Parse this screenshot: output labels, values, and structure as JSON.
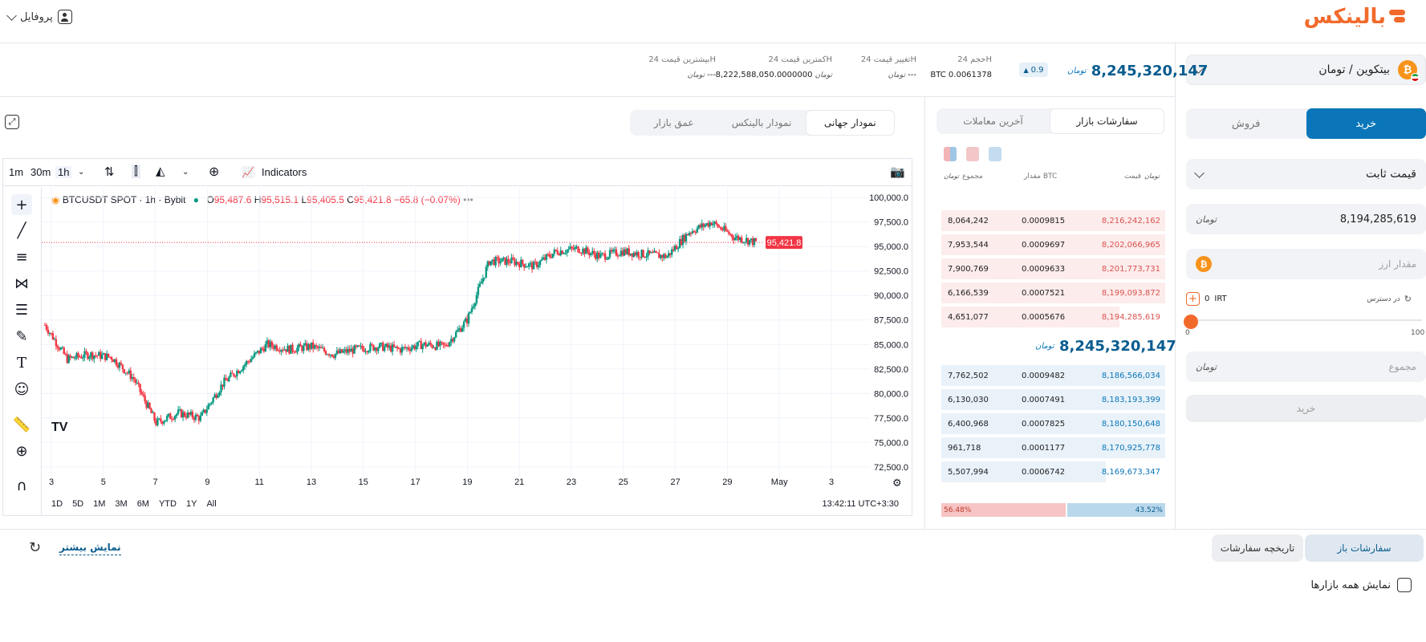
{
  "header": {
    "logo_text": "بالینکس",
    "profile_label": "پروفایل"
  },
  "trade_panel": {
    "pair_label": "بیتکوین / تومان",
    "tabs": [
      "خرید",
      "فروش"
    ],
    "order_type": "قیمت ثابت",
    "price_value": "8,194,285,619",
    "price_unit": "تومان",
    "amount_placeholder": "مقدار ارز",
    "available_label": "در دسترس",
    "available_value": "0",
    "available_unit": "IRT",
    "slider_min": "0",
    "slider_max": "100",
    "slider_level": 0,
    "total_placeholder": "مجموع",
    "submit_label": "خرید"
  },
  "stats": {
    "last_price": "8,245,320,147",
    "change_badge": "0.9",
    "volume_label": "حجم 24H",
    "volume_value": "BTC 0.0061378",
    "change_label": "تغییر قیمت 24H",
    "change_value": "---",
    "low_label": "کمترین قیمت 24H",
    "low_value": "8,222,588,050.0000000",
    "high_label": "بیشترین قیمت 24H",
    "high_value": "---"
  },
  "orderbook": {
    "tabs": [
      "سفارشات بازار",
      "آخرین معاملات"
    ],
    "headers": [
      "قیمت",
      "مقدار BTC",
      "مجموع"
    ],
    "asks": [
      [
        "8,216,242,162",
        "0.0009815",
        "8,064,242"
      ],
      [
        "8,202,066,965",
        "0.0009697",
        "7,953,544"
      ],
      [
        "8,201,773,731",
        "0.0009633",
        "7,900,769"
      ],
      [
        "8,199,093,872",
        "0.0007521",
        "6,166,539"
      ],
      [
        "8,194,285,619",
        "0.0005676",
        "4,651,077"
      ]
    ],
    "mid_price": "8,245,320,147",
    "bids": [
      [
        "8,186,566,034",
        "0.0009482",
        "7,762,502"
      ],
      [
        "8,183,193,399",
        "0.0007491",
        "6,130,030"
      ],
      [
        "8,180,150,648",
        "0.0007825",
        "6,400,968"
      ],
      [
        "8,170,925,778",
        "0.0001177",
        "961,718"
      ],
      [
        "8,169,673,347",
        "0.0006742",
        "5,507,994"
      ]
    ],
    "sell_ratio": "56.48%",
    "buy_ratio": "43.52%"
  },
  "chart_tabs": [
    "نمودار جهانی",
    "نمودار بالینکس",
    "عمق بازار"
  ],
  "tradingview": {
    "intervals": [
      "1m",
      "30m",
      "1h"
    ],
    "indicators_label": "Indicators",
    "symbol": "BTCUSDT SPOT · 1h · Bybit",
    "ohlc": {
      "o_label": "O",
      "o": "95,487.6",
      "h_label": "H",
      "h": "95,515.1",
      "l_label": "L",
      "l": "95,405.5",
      "c_label": "C",
      "c": "95,421.8",
      "chg": "−65.8 (−0.07%)"
    },
    "price_tag": "95,421.8",
    "ranges": [
      "1D",
      "5D",
      "1M",
      "3M",
      "6M",
      "YTD",
      "1Y",
      "All"
    ],
    "clock": "13:42:11 UTC+3:30"
  },
  "chart_data": {
    "type": "line",
    "title": "BTCUSDT SPOT · 1h · Bybit",
    "x_ticks": [
      "3",
      "5",
      "7",
      "9",
      "11",
      "13",
      "15",
      "17",
      "19",
      "21",
      "23",
      "25",
      "27",
      "29",
      "May",
      "3"
    ],
    "y_ticks": [
      "100,000.0",
      "97,500.0",
      "95,000.0",
      "92,500.0",
      "90,000.0",
      "87,500.0",
      "85,000.0",
      "82,500.0",
      "80,000.0",
      "77,500.0",
      "75,000.0",
      "72,500.0"
    ],
    "ylim": [
      71500,
      101000
    ],
    "series": [
      {
        "x": [
          "Apr 2",
          "Apr 3",
          "Apr 4",
          "Apr 5",
          "Apr 6",
          "Apr 7",
          "Apr 8",
          "Apr 9",
          "Apr 10",
          "Apr 11",
          "Apr 12",
          "Apr 13",
          "Apr 14",
          "Apr 15",
          "Apr 16",
          "Apr 17",
          "Apr 18",
          "Apr 19",
          "Apr 20",
          "Apr 21",
          "Apr 22",
          "Apr 23",
          "Apr 24",
          "Apr 25",
          "Apr 26",
          "Apr 27",
          "Apr 28",
          "Apr 29",
          "Apr 30",
          "May 1",
          "May 2",
          "May 3",
          "May 4"
        ],
        "values": [
          87000,
          83500,
          84000,
          83700,
          81500,
          77000,
          78000,
          77500,
          81000,
          83000,
          85000,
          84500,
          84800,
          84000,
          84500,
          84800,
          84500,
          85000,
          84800,
          87500,
          93500,
          93500,
          93000,
          94500,
          94800,
          94000,
          94500,
          94200,
          94000,
          96500,
          97500,
          96000,
          95421.8
        ]
      }
    ]
  },
  "bottom": {
    "tabs": [
      "سفارشات باز",
      "تاریخچه سفارشات"
    ],
    "show_more": "نمایش بیشتر",
    "show_all_markets": "نمایش همه بازارها"
  },
  "colors": {
    "accent": "#0a76b9",
    "brand": "#f26a2b",
    "ask": "#d9534f",
    "bid": "#0a76b9",
    "up": "#089981",
    "down": "#f23645"
  }
}
